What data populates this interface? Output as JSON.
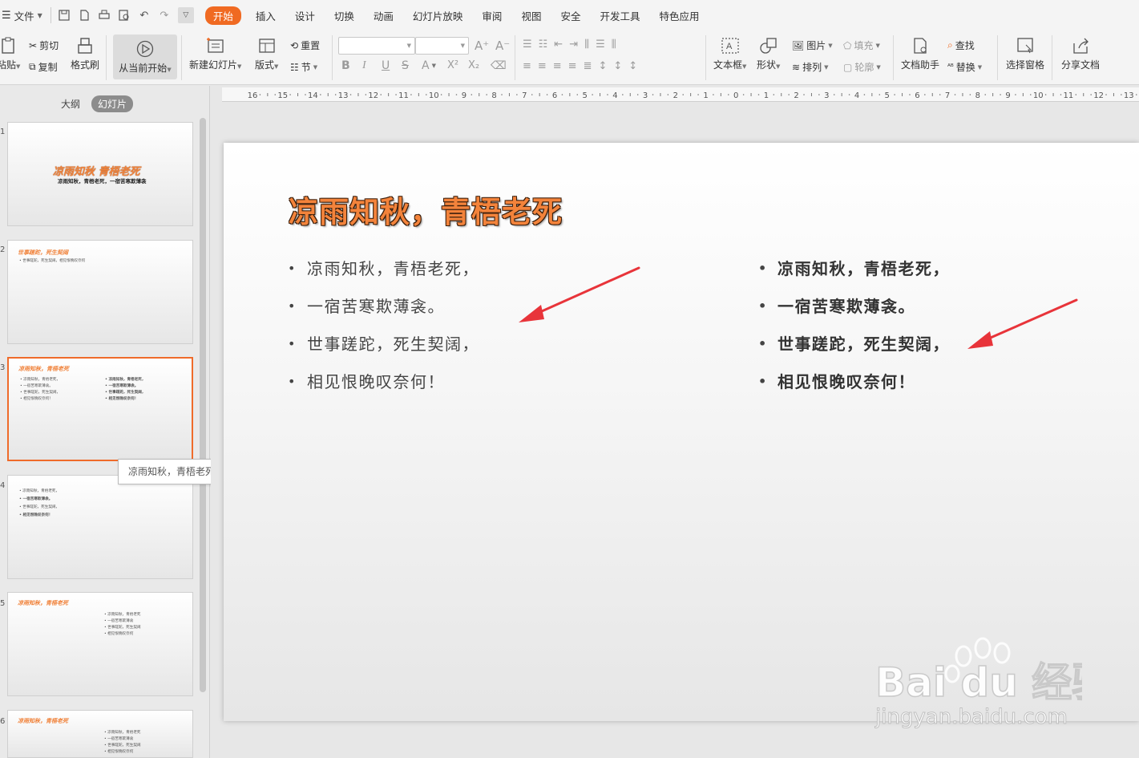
{
  "menu": {
    "file": "文件",
    "tabs": [
      {
        "label": "开始",
        "active": true
      },
      {
        "label": "插入"
      },
      {
        "label": "设计"
      },
      {
        "label": "切换"
      },
      {
        "label": "动画"
      },
      {
        "label": "幻灯片放映"
      },
      {
        "label": "审阅"
      },
      {
        "label": "视图"
      },
      {
        "label": "安全"
      },
      {
        "label": "开发工具"
      },
      {
        "label": "特色应用"
      }
    ]
  },
  "ribbon": {
    "paste": "粘贴",
    "cut": "剪切",
    "copy": "复制",
    "format_painter": "格式刷",
    "from_current": "从当前开始",
    "new_slide": "新建幻灯片",
    "layout": "版式",
    "reset": "重置",
    "section": "节",
    "fill": "填充",
    "picture": "图片",
    "arrange": "排列",
    "outline": "轮廓",
    "textbox": "文本框",
    "shape": "形状",
    "doc_assistant": "文档助手",
    "find": "查找",
    "replace": "替换",
    "select_pane": "选择窗格",
    "share_doc": "分享文档"
  },
  "panel": {
    "tab_outline": "大纲",
    "tab_slides": "幻灯片",
    "tooltip": "凉雨知秋，青梧老死"
  },
  "thumbnails": [
    {
      "num": "1",
      "title": "凉雨知秋 青梧老死",
      "subtitle": "凉雨知秋，青梧老死，一宿苦寒欺薄衾"
    },
    {
      "num": "2",
      "title": "世事蹉跎，死生契阔",
      "lines": [
        "• 世事蹉跎，死生契阔，相见恨晚叹奈何"
      ]
    },
    {
      "num": "3",
      "title": "凉雨知秋，青梧老死",
      "left_lines": [
        "• 凉雨知秋，青梧老死，",
        "• 一宿苦寒欺薄衾。",
        "• 世事蹉跎，死生契阔，",
        "• 相见恨晚叹奈何！"
      ],
      "right_lines": [
        "• 凉雨知秋，青梧老死，",
        "• 一宿苦寒欺薄衾。",
        "• 世事蹉跎，死生契阔，",
        "• 相见恨晚叹奈何！"
      ]
    },
    {
      "num": "4",
      "lines": [
        "• 凉雨知秋，青梧老死，",
        "• 一宿苦寒欺薄衾。",
        "• 世事蹉跎，死生契阔，",
        "• 相见恨晚叹奈何！"
      ]
    },
    {
      "num": "5",
      "title": "凉雨知秋，青梧老死",
      "lines": [
        "• 凉雨知秋，青梧老死",
        "• 一宿苦寒欺薄衾",
        "• 世事蹉跎，死生契阔",
        "• 相见恨晚叹奈何"
      ]
    },
    {
      "num": "6",
      "title": "凉雨知秋，青梧老死",
      "lines": [
        "• 凉雨知秋，青梧老死",
        "• 一宿苦寒欺薄衾",
        "• 世事蹉跎，死生契阔",
        "• 相见恨晚叹奈何"
      ]
    }
  ],
  "slide": {
    "title": "凉雨知秋，青梧老死",
    "left_items": [
      "凉雨知秋，青梧老死，",
      "一宿苦寒欺薄衾。",
      "世事蹉跎，死生契阔，",
      "相见恨晚叹奈何！"
    ],
    "right_items": [
      "凉雨知秋，青梧老死，",
      "一宿苦寒欺薄衾。",
      "世事蹉跎，死生契阔，",
      "相见恨晚叹奈何！"
    ]
  },
  "ruler_labels": [
    "16",
    "15",
    "14",
    "13",
    "12",
    "11",
    "10",
    "9",
    "8",
    "7",
    "6",
    "5",
    "4",
    "3",
    "2",
    "1",
    "0",
    "1",
    "2",
    "3",
    "4",
    "5",
    "6",
    "7",
    "8",
    "9",
    "10",
    "11",
    "12",
    "13"
  ],
  "watermark": {
    "brand": "Bai du 经验",
    "url": "jingyan.baidu.com"
  },
  "colors": {
    "accent": "#f06a22",
    "title_fill": "#f3833b",
    "arrow": "#e8343a"
  }
}
